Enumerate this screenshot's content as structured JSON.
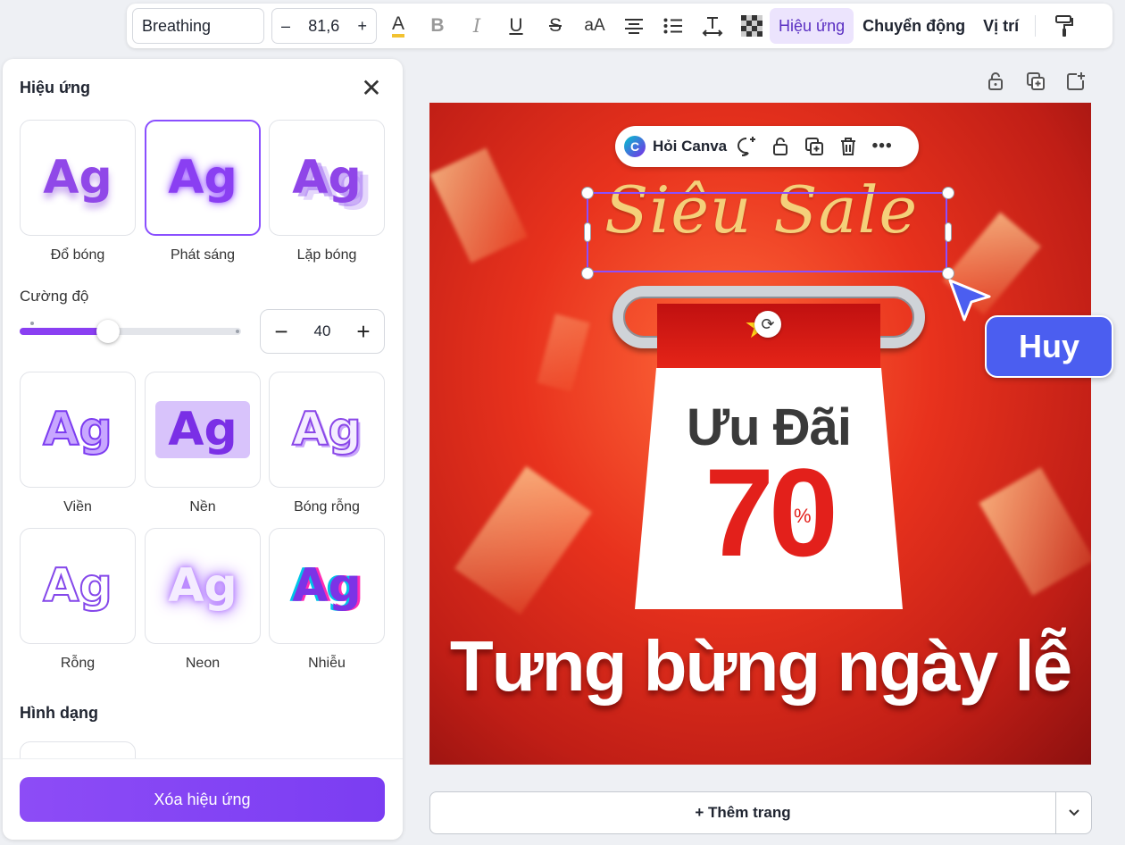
{
  "toolbar": {
    "font": "Breathing",
    "font_size": "81,6",
    "minus": "–",
    "plus": "+",
    "effects_label": "Hiệu ứng",
    "animate_label": "Chuyển động",
    "position_label": "Vị trí",
    "case_label": "aA"
  },
  "panel": {
    "title": "Hiệu ứng",
    "effects": [
      {
        "label": "Đổ bóng",
        "sample": "Ag"
      },
      {
        "label": "Phát sáng",
        "sample": "Ag"
      },
      {
        "label": "Lặp bóng",
        "sample": "Ag"
      },
      {
        "label": "Viền",
        "sample": "Ag"
      },
      {
        "label": "Nền",
        "sample": "Ag"
      },
      {
        "label": "Bóng rỗng",
        "sample": "Ag"
      },
      {
        "label": "Rỗng",
        "sample": "Ag"
      },
      {
        "label": "Neon",
        "sample": "Ag"
      },
      {
        "label": "Nhiễu",
        "sample": "Ag"
      }
    ],
    "selected_effect": "Phát sáng",
    "intensity_label": "Cường độ",
    "intensity_value": "40",
    "intensity_min": 0,
    "intensity_max": 100,
    "shape_title": "Hình dạng",
    "clear_button": "Xóa hiệu ứng"
  },
  "context_bar": {
    "ask_label": "Hỏi Canva",
    "logo_letter": "C"
  },
  "design": {
    "script_title": "Siêu Sale",
    "offer_label": "Ưu Đãi",
    "discount": "70",
    "percent": "%",
    "headline": "Tưng bừng ngày lễ"
  },
  "collaborator": {
    "name": "Huy",
    "color": "#4b5ef0"
  },
  "add_page": {
    "label": "+ Thêm trang"
  },
  "colors": {
    "accent": "#8a3ff2",
    "background_red": "#e8321d",
    "gold": "#f4d07a"
  }
}
